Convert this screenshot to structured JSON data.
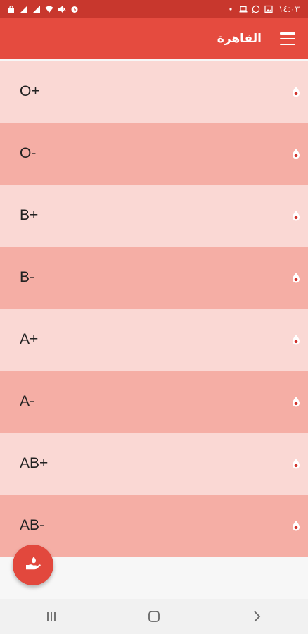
{
  "status_bar": {
    "time": "١٤:٠٣",
    "left_icons": [
      "lock-icon",
      "signal-icon",
      "signal-icon",
      "wifi-icon",
      "mute-icon",
      "alarm-icon"
    ],
    "right_icons": [
      "dot-icon",
      "laptop-icon",
      "whatsapp-icon",
      "image-icon"
    ]
  },
  "app_bar": {
    "title": "القاهرة",
    "menu_icon": "hamburger-menu-icon"
  },
  "blood_types": [
    {
      "label": "O+"
    },
    {
      "label": "O-"
    },
    {
      "label": "B+"
    },
    {
      "label": "B-"
    },
    {
      "label": "A+"
    },
    {
      "label": "A-"
    },
    {
      "label": "AB+"
    },
    {
      "label": "AB-"
    }
  ],
  "row_icon": "blood-drop-icon",
  "fab": {
    "icon": "donate-hand-icon"
  },
  "nav_bar": {
    "buttons": [
      "recents-button",
      "home-button",
      "back-button"
    ]
  },
  "colors": {
    "status_bar": "#c8372d",
    "app_bar": "#e54b3f",
    "row_light": "#fad8d4",
    "row_dark": "#f5aea5",
    "fab": "#e2483d",
    "drop": "#d1322a"
  }
}
